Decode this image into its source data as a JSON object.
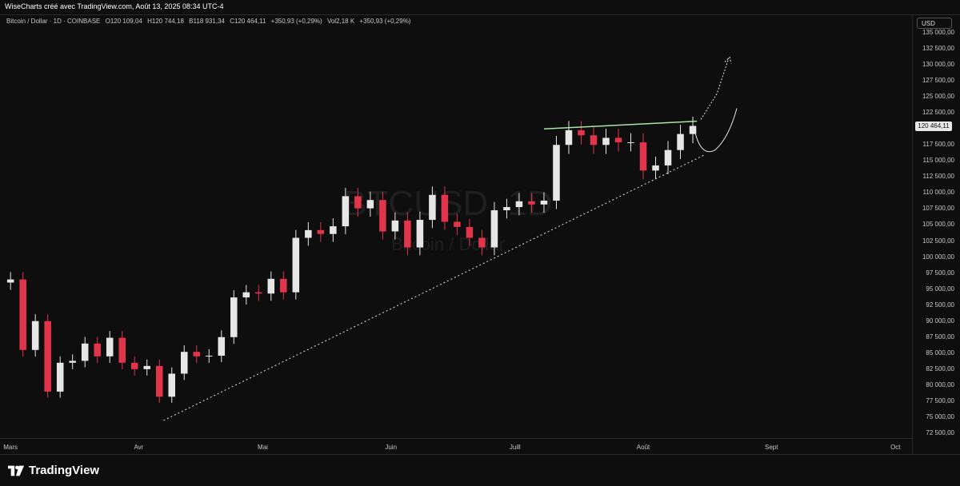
{
  "header": {
    "attribution": "WiseCharts créé avec TradingView.com, Août 13, 2025 08:34 UTC-4"
  },
  "legend": {
    "symbol": "Bitcoin / Dollar · 1D · COINBASE",
    "open": "O120 109,04",
    "high": "H120 744,18",
    "low": "B118 931,34",
    "close": "C120 464,11",
    "change": "+350,93 (+0,29%)",
    "volume": "Vol2,18 K",
    "vol_change": "+350,93 (+0,29%)"
  },
  "currency_button": "USD",
  "last_price_label": "120 464,11",
  "watermark": {
    "ticker": "BTCUSD, 1D",
    "name": "Bitcoin / Dollar"
  },
  "price_axis": [
    "135 000,00",
    "132 500,00",
    "130 000,00",
    "127 500,00",
    "125 000,00",
    "122 500,00",
    "117 500,00",
    "115 000,00",
    "112 500,00",
    "110 000,00",
    "107 500,00",
    "105 000,00",
    "102 500,00",
    "100 000,00",
    "97 500,00",
    "95 000,00",
    "92 500,00",
    "90 000,00",
    "87 500,00",
    "85 000,00",
    "82 500,00",
    "80 000,00",
    "77 500,00",
    "75 000,00",
    "72 500,00"
  ],
  "time_axis": [
    "Mars",
    "Avr",
    "Mai",
    "Juin",
    "Juill",
    "Août",
    "Sept",
    "Oct"
  ],
  "footer": {
    "brand": "TradingView"
  },
  "colors": {
    "up": "#e6e6e6",
    "down": "#e0354b",
    "resistance": "#a8e6a8",
    "trendline": "#e6e6e6"
  },
  "chart_data": {
    "type": "candlestick",
    "title": "Bitcoin / Dollar · 1D · COINBASE",
    "ylim": [
      72500,
      135000
    ],
    "x_range": [
      "2025-02-28",
      "2025-10-05"
    ],
    "series": [
      {
        "dates": [
          "2025-03-01",
          "2025-03-04",
          "2025-03-07",
          "2025-03-10",
          "2025-03-13",
          "2025-03-16",
          "2025-03-19",
          "2025-03-22",
          "2025-03-25",
          "2025-03-28",
          "2025-03-31",
          "2025-04-03",
          "2025-04-06",
          "2025-04-09",
          "2025-04-12",
          "2025-04-15",
          "2025-04-18",
          "2025-04-21",
          "2025-04-24",
          "2025-04-27",
          "2025-04-30",
          "2025-05-03",
          "2025-05-06",
          "2025-05-09",
          "2025-05-12",
          "2025-05-15",
          "2025-05-18",
          "2025-05-21",
          "2025-05-24",
          "2025-05-27",
          "2025-05-30",
          "2025-06-02",
          "2025-06-05",
          "2025-06-08",
          "2025-06-11",
          "2025-06-14",
          "2025-06-17",
          "2025-06-20",
          "2025-06-23",
          "2025-06-26",
          "2025-06-29",
          "2025-07-02",
          "2025-07-05",
          "2025-07-08",
          "2025-07-11",
          "2025-07-14",
          "2025-07-17",
          "2025-07-20",
          "2025-07-23",
          "2025-07-26",
          "2025-07-29",
          "2025-08-01",
          "2025-08-04",
          "2025-08-07",
          "2025-08-10",
          "2025-08-13"
        ],
        "values": [
          96500,
          85500,
          90000,
          79000,
          83500,
          83800,
          86500,
          84500,
          87400,
          83500,
          82500,
          83000,
          78200,
          81800,
          85200,
          84500,
          84600,
          87500,
          93700,
          94500,
          94300,
          96600,
          94500,
          103000,
          104200,
          103600,
          104800,
          109500,
          107600,
          108900,
          104000,
          105700,
          101500,
          105800,
          109700,
          105500,
          104700,
          103000,
          101500,
          107300,
          107800,
          108700,
          108200,
          108800,
          117500,
          119800,
          119000,
          117500,
          118600,
          117900,
          117900,
          113500,
          114300,
          116700,
          119200,
          120464
        ]
      }
    ],
    "annotations": [
      {
        "type": "trendline",
        "from": [
          "2025-04-07",
          74500
        ],
        "to": [
          "2025-08-16",
          116000
        ]
      },
      {
        "type": "resistance",
        "from": [
          "2025-07-08",
          120000
        ],
        "to": [
          "2025-08-14",
          121200
        ]
      }
    ]
  }
}
